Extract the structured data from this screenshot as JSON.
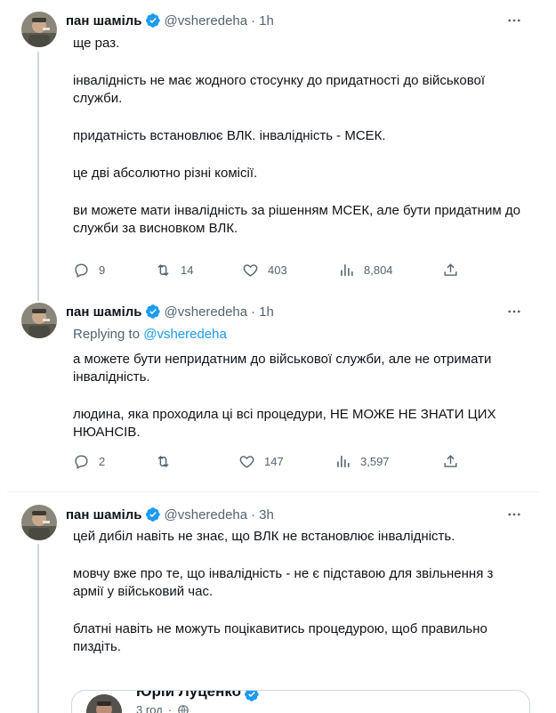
{
  "tweets": [
    {
      "name": "пан шаміль",
      "handle": "@vsheredeha",
      "time": "1h",
      "paragraphs": [
        "ще раз.",
        "інвалідність не має жодного стосунку до придатності до військової служби.",
        "придатність встановлює ВЛК. інвалідність - МСЕК.",
        "це дві абсолютно різні комісії.",
        "ви можете мати інвалідність за рішенням МСЕК, але бути придатним до служби за висновком ВЛК."
      ],
      "replies": "9",
      "retweets": "14",
      "likes": "403",
      "views": "8,804"
    },
    {
      "name": "пан шаміль",
      "handle": "@vsheredeha",
      "time": "1h",
      "replying_to_label": "Replying to",
      "replying_to_handle": "@vsheredeha",
      "paragraphs": [
        "а можете бути непридатним до військової служби, але не отримати інвалідність.",
        "людина, яка проходила ці всі процедури, НЕ МОЖЕ НЕ ЗНАТИ ЦИХ НЮАНСІВ."
      ],
      "replies": "2",
      "retweets": "",
      "likes": "147",
      "views": "3,597"
    },
    {
      "name": "пан шаміль",
      "handle": "@vsheredeha",
      "time": "3h",
      "paragraphs": [
        "цей дибіл навіть не знає, що ВЛК не встановлює інвалідність.",
        "мовчу вже про те, що інвалідність - не є підставою для звільнення з армії у військовий час.",
        "блатні навіть не можуть поцікавитись процедурою, щоб правильно пиздіть."
      ],
      "quote": {
        "name": "Юрій Луценко",
        "time": "3 год"
      }
    }
  ],
  "colors": {
    "text": "#0f1419",
    "secondary": "#536471",
    "accent": "#1d9bf0",
    "border": "#cfd9de"
  },
  "icons": [
    "verified-icon",
    "more-icon",
    "reply-icon",
    "retweet-icon",
    "like-icon",
    "views-icon",
    "share-icon",
    "globe-icon"
  ]
}
